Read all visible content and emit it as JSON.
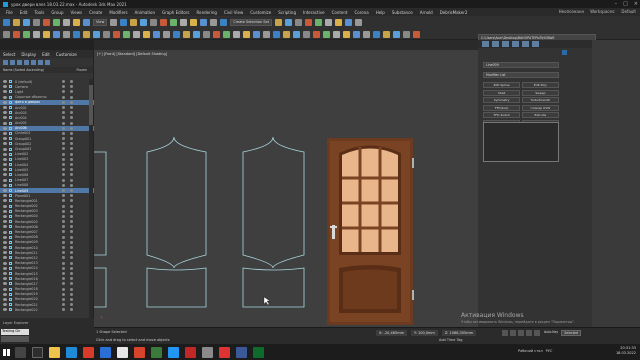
{
  "window": {
    "title": "урок двери влез 18.03.22.max - Autodesk 3ds Max 2021"
  },
  "menubar": {
    "items": [
      "File",
      "Edit",
      "Tools",
      "Group",
      "Views",
      "Create",
      "Modifiers",
      "Animation",
      "Graph Editors",
      "Rendering",
      "Civil View",
      "Customize",
      "Scripting",
      "Interactive",
      "Content",
      "Corona",
      "Help",
      "Substance",
      "Arnold",
      "DebrisMaker2"
    ],
    "user_label": "Неопознанн",
    "workspace_label": "Workspaces:",
    "workspace_value": "Default"
  },
  "toolbar": {
    "selection_set": "Create Selection Set",
    "view_dropdown": "View",
    "path": "C:\\Users\\Acer\\Desktop\\ВАНОРАТЕРЬЯ\\НОВЫЕ"
  },
  "scene_explorer": {
    "tabs": [
      "Select",
      "Display",
      "Edit",
      "Customize"
    ],
    "column_name": "Name (Sorted Ascending)",
    "column_frozen": "Frozen",
    "rows": [
      {
        "name": "0 (default)",
        "selected": false
      },
      {
        "name": "Camera",
        "selected": false
      },
      {
        "name": "Light",
        "selected": false
      },
      {
        "name": "Скрытые объекты",
        "selected": false
      },
      {
        "name": "фото в дверях",
        "selected": true
      },
      {
        "name": "Arc002",
        "selected": false
      },
      {
        "name": "Arc003",
        "selected": false
      },
      {
        "name": "Arc004",
        "selected": false
      },
      {
        "name": "Arc005",
        "selected": false
      },
      {
        "name": "Arc006",
        "selected": true
      },
      {
        "name": "Circle001",
        "selected": false
      },
      {
        "name": "Group001",
        "selected": false
      },
      {
        "name": "Group002",
        "selected": false
      },
      {
        "name": "Group003",
        "selected": false
      },
      {
        "name": "Line002",
        "selected": false
      },
      {
        "name": "Line003",
        "selected": false
      },
      {
        "name": "Line004",
        "selected": false
      },
      {
        "name": "Line005",
        "selected": false
      },
      {
        "name": "Line006",
        "selected": false
      },
      {
        "name": "Line007",
        "selected": false
      },
      {
        "name": "Line008",
        "selected": false
      },
      {
        "name": "Line009",
        "selected": true
      },
      {
        "name": "Plane001",
        "selected": false
      },
      {
        "name": "Rectangle001",
        "selected": false
      },
      {
        "name": "Rectangle002",
        "selected": false
      },
      {
        "name": "Rectangle003",
        "selected": false
      },
      {
        "name": "Rectangle004",
        "selected": false
      },
      {
        "name": "Rectangle005",
        "selected": false
      },
      {
        "name": "Rectangle006",
        "selected": false
      },
      {
        "name": "Rectangle007",
        "selected": false
      },
      {
        "name": "Rectangle008",
        "selected": false
      },
      {
        "name": "Rectangle009",
        "selected": false
      },
      {
        "name": "Rectangle010",
        "selected": false
      },
      {
        "name": "Rectangle011",
        "selected": false
      },
      {
        "name": "Rectangle012",
        "selected": false
      },
      {
        "name": "Rectangle013",
        "selected": false
      },
      {
        "name": "Rectangle014",
        "selected": false
      },
      {
        "name": "Rectangle015",
        "selected": false
      },
      {
        "name": "Rectangle016",
        "selected": false
      },
      {
        "name": "Rectangle017",
        "selected": false
      },
      {
        "name": "Rectangle018",
        "selected": false
      },
      {
        "name": "Rectangle019",
        "selected": false
      },
      {
        "name": "Rectangle020",
        "selected": false
      },
      {
        "name": "Rectangle021",
        "selected": false
      },
      {
        "name": "Rectangle022",
        "selected": false
      }
    ]
  },
  "layer_explorer": {
    "label": "Layer Explorer"
  },
  "viewport": {
    "label": "[+] [Front] [Standard] [Default Shading]"
  },
  "command_panel": {
    "object_name": "Line009",
    "modifier_list": "Modifier List",
    "buttons": [
      "Edit Spline",
      "Edit Poly",
      "Shell",
      "Sweep",
      "Symmetry",
      "TurboSmooth",
      "FFD(box)",
      "Unwrap UVW",
      "FFD 4x4x4",
      "Extrude",
      "FFD(4x4)Offset",
      "DynamicModifier"
    ]
  },
  "maxscript": {
    "input": "Testing Dir"
  },
  "status": {
    "selection": "1 Shape Selected",
    "prompt": "Click and drag to select and move objects",
    "x": "X: -20,465mm",
    "y": "Y: 100,0mm",
    "z": "Z: 1068,305mm",
    "add_time_tag": "Add Time Tag",
    "auto_key": "Auto Key",
    "set_key": "Set Key",
    "selected": "Selected",
    "key_filters": "Key Filters..."
  },
  "watermark": {
    "line1": "Активация Windows",
    "line2": "Чтобы активировать Windows, перейдите в раздел \"Параметры\"."
  },
  "taskbar": {
    "desktop_label": "Рабочий стол",
    "lang": "РУС",
    "time": "20:31:33",
    "date": "18.03.2022"
  },
  "colors": {
    "selection_blue": "#4f78a6",
    "viewport_bg": "#3f3f3f",
    "spline_cyan": "#a9d8e0",
    "door_wood": "#6b3a1f",
    "glass": "#e8b68a"
  }
}
